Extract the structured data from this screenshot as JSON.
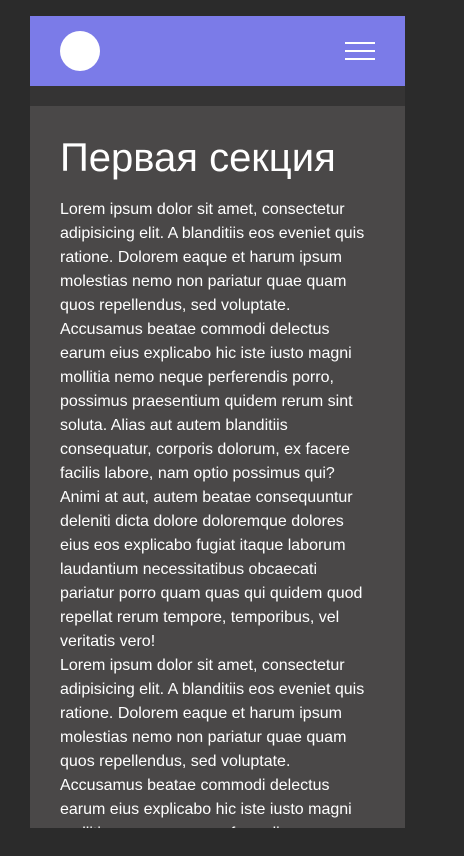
{
  "header": {
    "logo_icon": "circle-logo",
    "menu_icon": "hamburger-menu-icon"
  },
  "section": {
    "title": "Первая секция",
    "paragraphs": [
      "Lorem ipsum dolor sit amet, consectetur adipisicing elit. A blanditiis eos eveniet quis ratione. Dolorem eaque et harum ipsum molestias nemo non pariatur quae quam quos repellendus, sed voluptate. Accusamus beatae commodi delectus earum eius explicabo hic iste iusto magni mollitia nemo neque perferendis porro, possimus praesentium quidem rerum sint soluta. Alias aut autem blanditiis consequatur, corporis dolorum, ex facere facilis labore, nam optio possimus qui? Animi at aut, autem beatae consequuntur deleniti dicta dolore doloremque dolores eius eos explicabo fugiat itaque laborum laudantium necessitatibus obcaecati pariatur porro quam quas qui quidem quod repellat rerum tempore, temporibus, vel veritatis vero!",
      "Lorem ipsum dolor sit amet, consectetur adipisicing elit. A blanditiis eos eveniet quis ratione. Dolorem eaque et harum ipsum molestias nemo non pariatur quae quam quos repellendus, sed voluptate. Accusamus beatae commodi delectus earum eius explicabo hic iste iusto magni mollitia nemo neque perferendis porro, possimus praesentium quidem rerum sint soluta."
    ]
  },
  "colors": {
    "header_bg": "#7b7be8",
    "section_bg": "#4a4848",
    "page_bg": "#2b2b2b"
  }
}
